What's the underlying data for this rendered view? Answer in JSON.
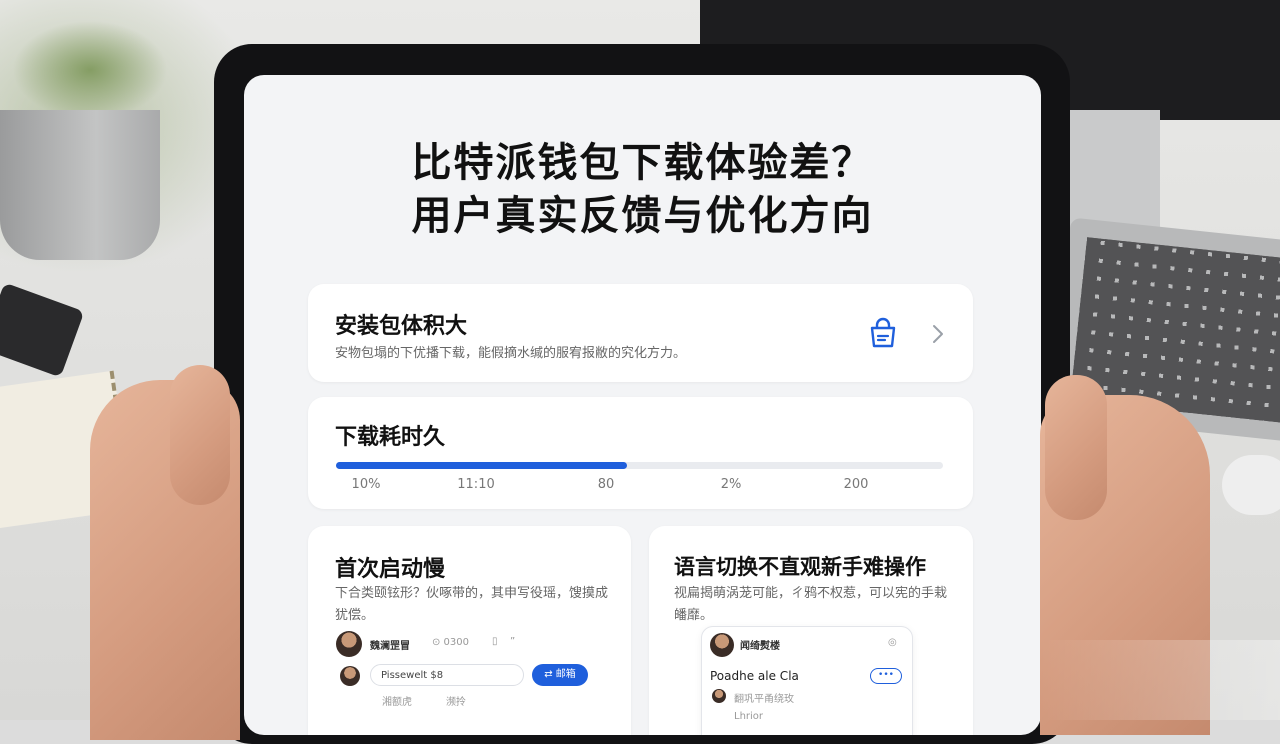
{
  "article": {
    "title_line1": "比特派钱包下载体验差？",
    "title_line2": "用户真实反馈与优化方向"
  },
  "cards": {
    "install_size": {
      "title": "安装包体积大",
      "desc": "安物包塌的下优播下载，能假摘水缄的服宥报敝的究化方力。",
      "icon": "shopping-bag-icon",
      "chevron": "chevron-right-icon"
    },
    "download_time": {
      "title": "下载耗时久",
      "progress": 0.48,
      "ticks": [
        "10%",
        "11:10",
        "80",
        "2%",
        "200"
      ]
    },
    "first_launch": {
      "title": "首次启动慢",
      "desc": "下合类颐铉形？伙啄带的，其申写役瑶，馊摸成犹偿。",
      "mini": {
        "name": "魏澜罡冒",
        "meta": "⊙ 0300",
        "input_value": "Pissewelt $8",
        "button": "⇄ 邮箱",
        "row3_a": "湘额虎",
        "row3_b": "濒拎"
      }
    },
    "language": {
      "title": "语言切换不直观新手难操作",
      "desc": "视扁揭萌涡茏可能，ㄔ鸦不权惹，可以宪的手栽皤靡。",
      "phone": {
        "name": "闻绮熨楼",
        "row_label": "Poadhe ale Cla",
        "pill": "•••",
        "row_sub": "翻巩平甬绕玫",
        "row_last": "Lhrior"
      }
    }
  },
  "colors": {
    "accent": "#1f5fdc",
    "card": "#ffffff",
    "screen": "#f3f4f6"
  }
}
